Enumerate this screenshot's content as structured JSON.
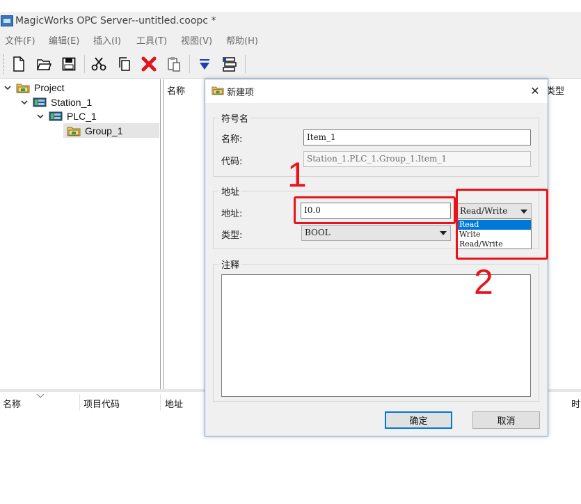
{
  "app": {
    "title": "MagicWorks OPC Server--untitled.coopc *"
  },
  "menu": [
    {
      "label": "文件(F)"
    },
    {
      "label": "编辑(E)"
    },
    {
      "label": "插入(I)"
    },
    {
      "label": "工具(T)"
    },
    {
      "label": "视图(V)"
    },
    {
      "label": "帮助(H)"
    }
  ],
  "toolbar": {
    "buttons": [
      "new-file-icon",
      "open-folder-icon",
      "save-icon",
      "cut-icon",
      "copy-icon",
      "delete-icon",
      "paste-icon",
      "filter-icon",
      "list-icon"
    ]
  },
  "tree": {
    "root": "Project",
    "station": "Station_1",
    "plc": "PLC_1",
    "group": "Group_1"
  },
  "items_panel": {
    "col_name": "名称",
    "col_type": "类型"
  },
  "bottom_panel": {
    "col_name": "名称",
    "col_code": "项目代码",
    "col_address": "地址",
    "col_time": "时"
  },
  "dialog": {
    "title": "新建项",
    "close_glyph": "✕",
    "symbol_group": "符号名",
    "name_label": "名称:",
    "name_value": "Item_1",
    "code_label": "代码:",
    "code_value": "Station_1.PLC_1.Group_1.Item_1",
    "address_group": "地址",
    "address_label": "地址:",
    "address_value": "I0.0",
    "access_value": "Read/Write",
    "access_options": [
      "Read",
      "Write",
      "Read/Write"
    ],
    "access_selected": "Read",
    "type_label": "类型:",
    "type_value": "BOOL",
    "comment_group": "注释",
    "comment_value": "",
    "ok_label": "确定",
    "cancel_label": "取消"
  },
  "annotations": {
    "marker_1": "1",
    "marker_2": "2"
  },
  "colors": {
    "highlight_red": "#e8141c",
    "selection_blue": "#0078d7"
  }
}
